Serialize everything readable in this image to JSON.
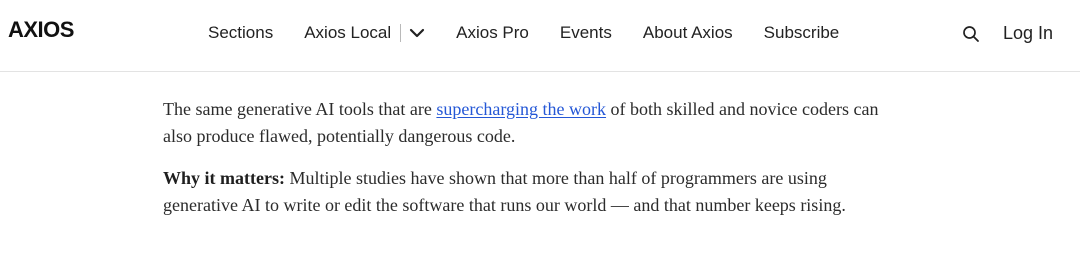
{
  "header": {
    "logo": "AXIOS",
    "nav": {
      "sections": "Sections",
      "axios_local": "Axios Local",
      "axios_pro": "Axios Pro",
      "events": "Events",
      "about": "About Axios",
      "subscribe": "Subscribe"
    },
    "login": "Log In",
    "icons": {
      "dropdown": "chevron-down-icon",
      "search": "search-icon"
    }
  },
  "article": {
    "p1": {
      "before_link": "The same generative AI tools that are ",
      "link_text": "supercharging the work",
      "after_link": " of both skilled and novice coders can also produce flawed, potentially dangerous code."
    },
    "p2": {
      "lead": "Why it matters:",
      "body": " Multiple studies have shown that more than half of programmers are using generative AI to write or edit the software that runs our world — and that number keeps rising."
    }
  },
  "colors": {
    "link": "#2457d6",
    "text": "#2b2b2b",
    "divider": "#e3e3e3"
  }
}
